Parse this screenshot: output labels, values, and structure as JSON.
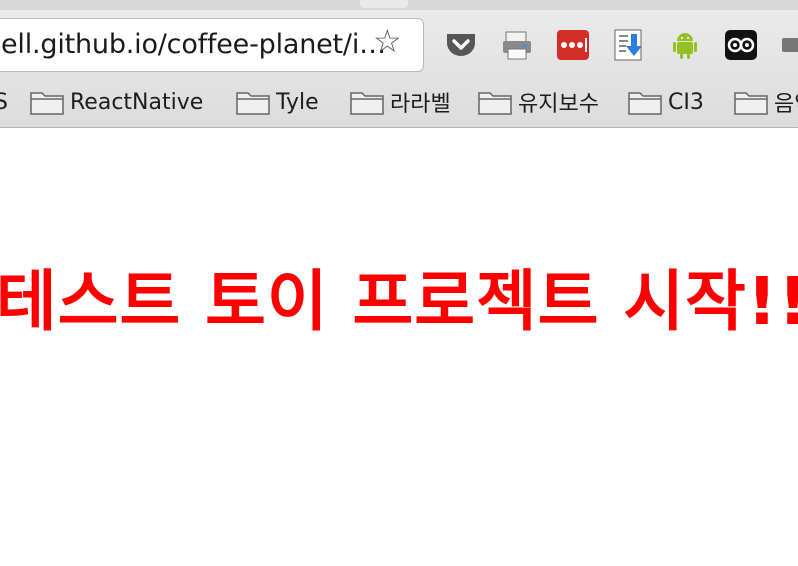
{
  "browser": {
    "url": "ell.github.io/coffee-planet/i…",
    "star_glyph": "☆",
    "extensions": [
      "pocket-icon",
      "printer-icon",
      "lastpass-icon",
      "download-icon",
      "android-icon",
      "owl-icon"
    ],
    "bookmarks": {
      "partial_first": "S",
      "items": [
        "ReactNative",
        "Tyle",
        "라라벨",
        "유지보수",
        "CI3",
        "음악"
      ]
    }
  },
  "page": {
    "headline": "테스트 토이 프로젝트 시작!!",
    "headline_color": "#ff0000"
  }
}
